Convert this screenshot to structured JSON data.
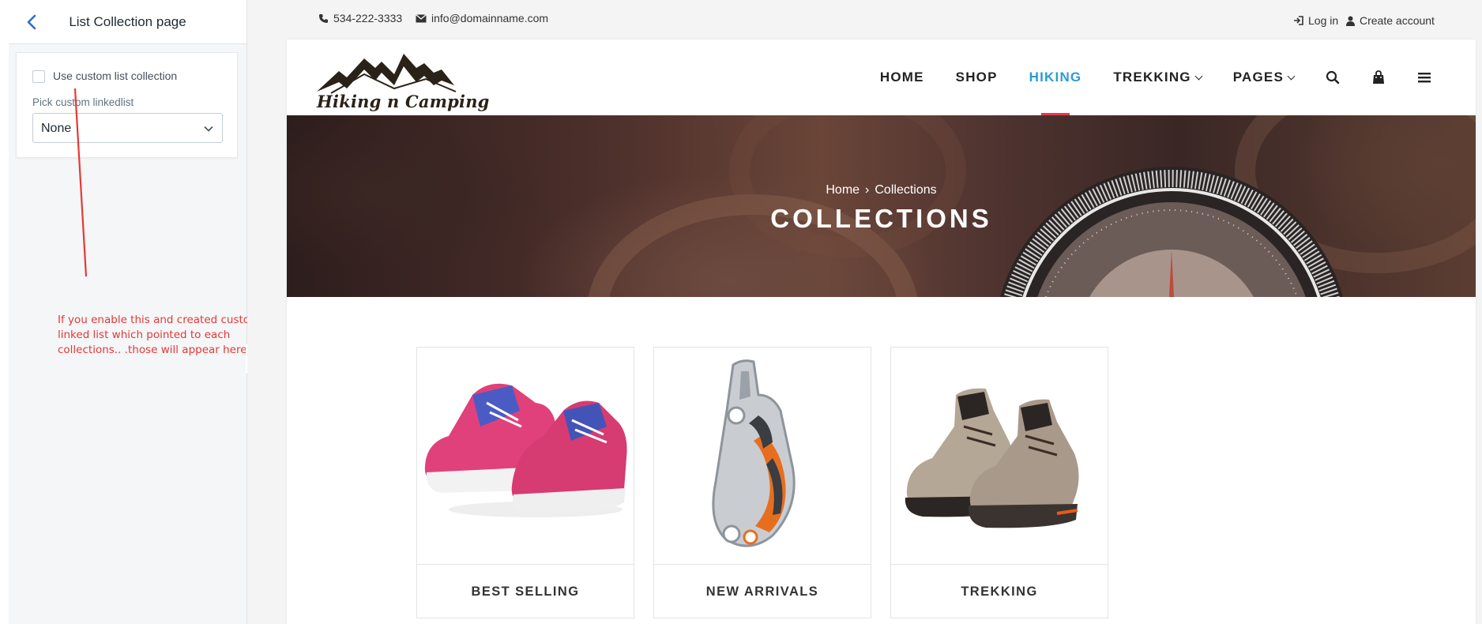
{
  "editor": {
    "title": "List Collection page",
    "checkbox_label": "Use custom list collection",
    "checkbox_checked": false,
    "pick_label": "Pick custom linkedlist",
    "select_value": "None",
    "annotation": "If you enable this and created custom linked list which pointed to each collections.. .those will appear here....",
    "annotation_color": "#e53935"
  },
  "utility_bar": {
    "phone": "534-222-3333",
    "email": "info@domainname.com",
    "login": "Log in",
    "create_account": "Create account"
  },
  "site": {
    "logo_text": "Hiking n Camping",
    "nav": [
      {
        "label": "HOME",
        "active": false,
        "dropdown": false
      },
      {
        "label": "SHOP",
        "active": false,
        "dropdown": false
      },
      {
        "label": "HIKING",
        "active": true,
        "dropdown": false
      },
      {
        "label": "TREKKING",
        "active": false,
        "dropdown": true
      },
      {
        "label": "PAGES",
        "active": false,
        "dropdown": true
      }
    ],
    "nav_icons": [
      "search-icon",
      "shopping-bag-icon",
      "menu-icon"
    ],
    "accent_color": "#2a9bd6",
    "active_underline_color": "#e8394b"
  },
  "banner": {
    "breadcrumb_home": "Home",
    "breadcrumb_separator": "›",
    "breadcrumb_current": "Collections",
    "title": "COLLECTIONS"
  },
  "collections": [
    {
      "label": "BEST SELLING",
      "image": "pink-running-shoes"
    },
    {
      "label": "NEW ARRIVALS",
      "image": "climbing-ascender"
    },
    {
      "label": "TREKKING",
      "image": "hiking-boots"
    }
  ]
}
